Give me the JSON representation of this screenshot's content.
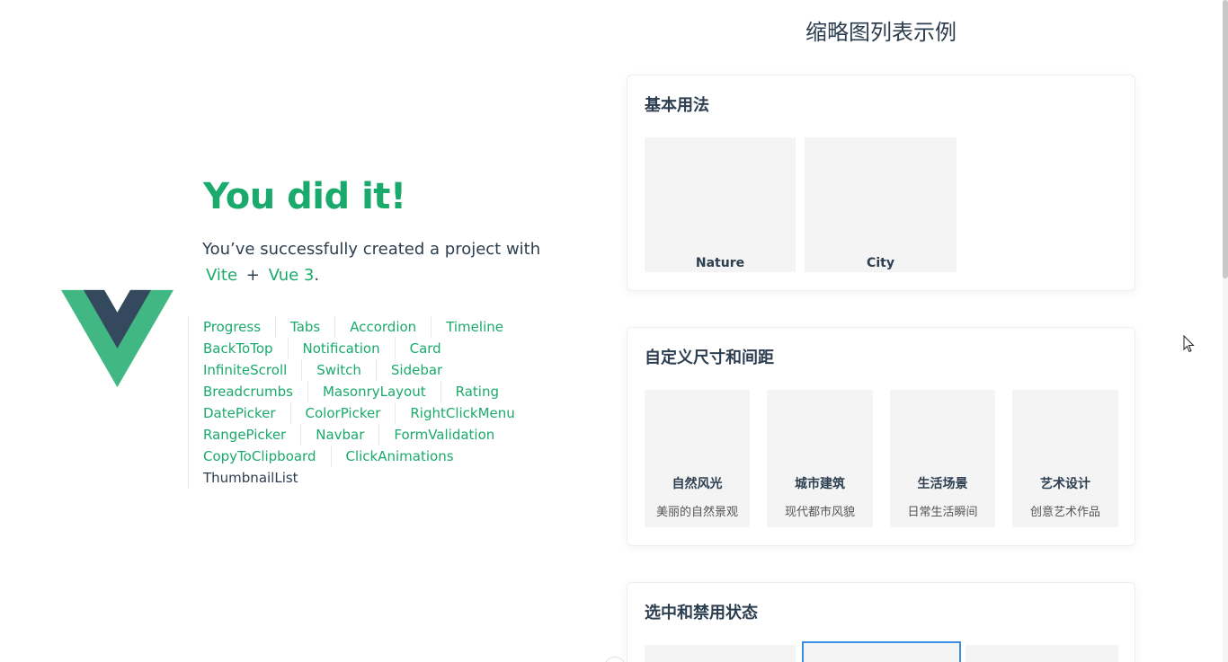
{
  "hero": {
    "title": "You did it!",
    "subtitle_prefix": "You’ve successfully created a project with",
    "vite": "Vite",
    "plus": "+",
    "vue": "Vue 3",
    "period": "."
  },
  "nav": {
    "rows": [
      [
        "Progress",
        "Tabs",
        "Accordion",
        "Timeline"
      ],
      [
        "BackToTop",
        "Notification",
        "Card"
      ],
      [
        "InfiniteScroll",
        "Switch",
        "Sidebar"
      ],
      [
        "Breadcrumbs",
        "MasonryLayout",
        "Rating"
      ],
      [
        "DatePicker",
        "ColorPicker",
        "RightClickMenu"
      ],
      [
        "RangePicker",
        "Navbar",
        "FormValidation"
      ],
      [
        "CopyToClipboard",
        "ClickAnimations"
      ],
      [
        "ThumbnailList"
      ]
    ],
    "active": "ThumbnailList"
  },
  "right": {
    "title": "缩略图列表示例",
    "cards": [
      {
        "title": "基本用法",
        "items": [
          {
            "label": "Nature"
          },
          {
            "label": "City"
          }
        ]
      },
      {
        "title": "自定义尺寸和间距",
        "items": [
          {
            "label": "自然风光",
            "desc": "美丽的自然景观"
          },
          {
            "label": "城市建筑",
            "desc": "现代都市风貌"
          },
          {
            "label": "生活场景",
            "desc": "日常生活瞬间"
          },
          {
            "label": "艺术设计",
            "desc": "创意艺术作品"
          }
        ]
      },
      {
        "title": "选中和禁用状态"
      }
    ]
  },
  "colors": {
    "accent": "#1aaa6b",
    "text": "#2c3e50",
    "thumb_bg": "#f4f4f4",
    "selected_border": "#3a8ee6"
  }
}
